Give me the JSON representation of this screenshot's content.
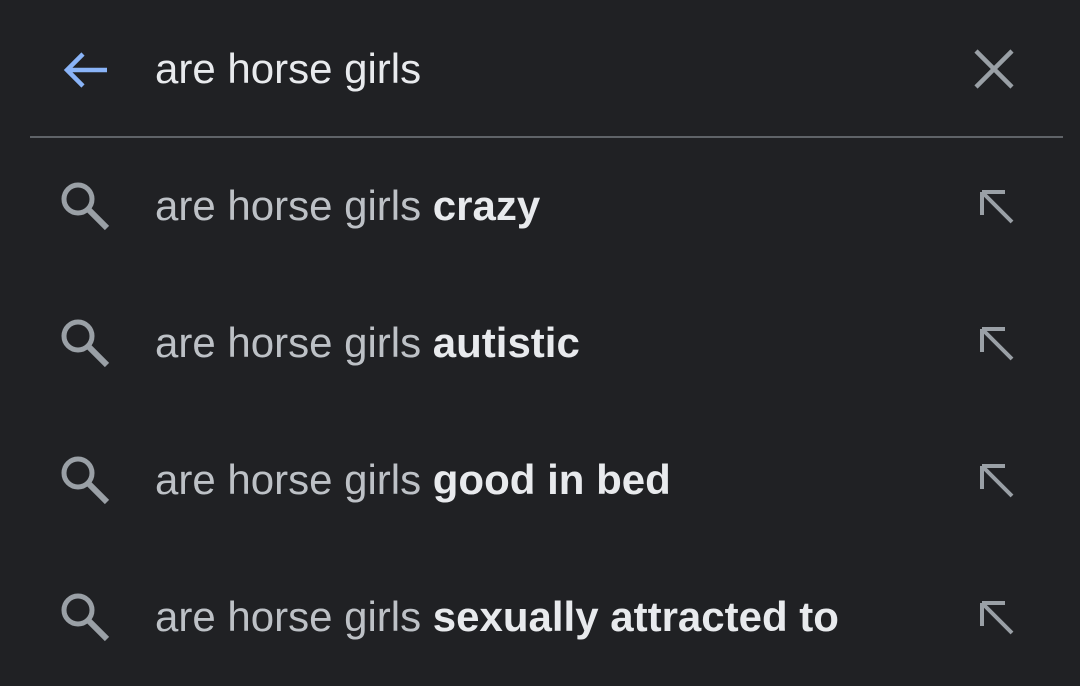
{
  "search": {
    "query": "are horse girls",
    "back_icon": "arrow-back-icon",
    "clear_icon": "close-icon"
  },
  "colors": {
    "background": "#202124",
    "accent": "#8ab4f8",
    "text": "#e8eaed",
    "muted_text": "#bdc1c6",
    "icon": "#9aa0a6"
  },
  "suggestions": [
    {
      "prefix": "are horse girls ",
      "completion": "crazy",
      "icon": "search-icon",
      "action_icon": "arrow-up-left-icon"
    },
    {
      "prefix": "are horse girls ",
      "completion": "autistic",
      "icon": "search-icon",
      "action_icon": "arrow-up-left-icon"
    },
    {
      "prefix": "are horse girls ",
      "completion": "good in bed",
      "icon": "search-icon",
      "action_icon": "arrow-up-left-icon"
    },
    {
      "prefix": "are horse girls ",
      "completion": "sexually attracted to",
      "icon": "search-icon",
      "action_icon": "arrow-up-left-icon"
    }
  ]
}
